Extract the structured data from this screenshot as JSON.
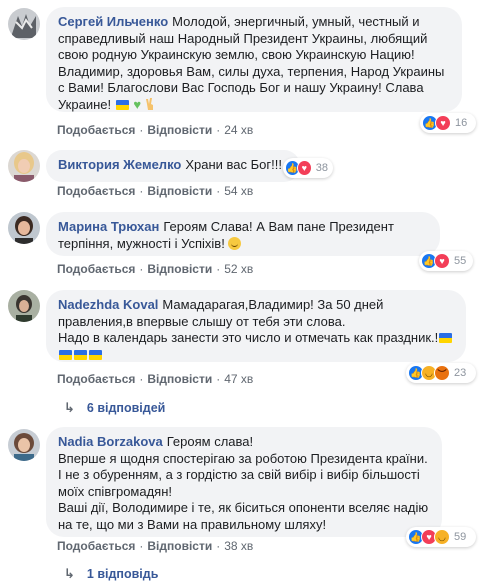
{
  "comments": [
    {
      "author": "Сергей Ильченко",
      "text": "Молодой, энергичный, умный, честный и справедливый наш Народный Президент Украины, любящий свою родную Украинскую землю, свою Украинскую Нацию! Владимир, здоровья Вам, силы духа, терпения, Народ Украины с Вами! Благослови Вас Господь Бог и нашу Украину! Слава Украине!",
      "actions": {
        "like": "Подобається",
        "reply": "Відповісти",
        "time": "24 хв"
      },
      "reactions": {
        "count": "16",
        "types": [
          "like",
          "love"
        ]
      }
    },
    {
      "author": "Виктория Жемелко",
      "text": "Храни вас Бог!!!",
      "actions": {
        "like": "Подобається",
        "reply": "Відповісти",
        "time": "54 хв"
      },
      "reactions": {
        "count": "38",
        "types": [
          "like",
          "love"
        ]
      }
    },
    {
      "author": "Марина Трюхан",
      "text": "Героям Слава! А Вам пане Президент терпіння, мужності і Успіхів!",
      "actions": {
        "like": "Подобається",
        "reply": "Відповісти",
        "time": "52 хв"
      },
      "reactions": {
        "count": "55",
        "types": [
          "like",
          "love"
        ]
      }
    },
    {
      "author": "Nadezhda Koval",
      "text": "Мамадарагая,Владимир! За 50 дней правления,в впервые слышу от тебя эти слова.\nНадо в календарь занести это число и отмечать как праздник.!",
      "actions": {
        "like": "Подобається",
        "reply": "Відповісти",
        "time": "47 хв"
      },
      "reactions": {
        "count": "23",
        "types": [
          "like",
          "haha",
          "angry"
        ]
      },
      "replies": "6 відповідей"
    },
    {
      "author": "Nadia Borzakova",
      "text": "Героям слава!\nВперше я щодня спостерігаю за роботою Президента країни. І не з обуренням, а з гордістю за свій вибір і вибір більшості моїх співгромадян!\nВаші дії, Володимире і те, як біситься опоненти вселяє надію на те, що ми з Вами на правильному шляху!",
      "actions": {
        "like": "Подобається",
        "reply": "Відповісти",
        "time": "38 хв"
      },
      "reactions": {
        "count": "59",
        "types": [
          "like",
          "love",
          "haha"
        ]
      },
      "replies": "1 відповідь"
    }
  ]
}
